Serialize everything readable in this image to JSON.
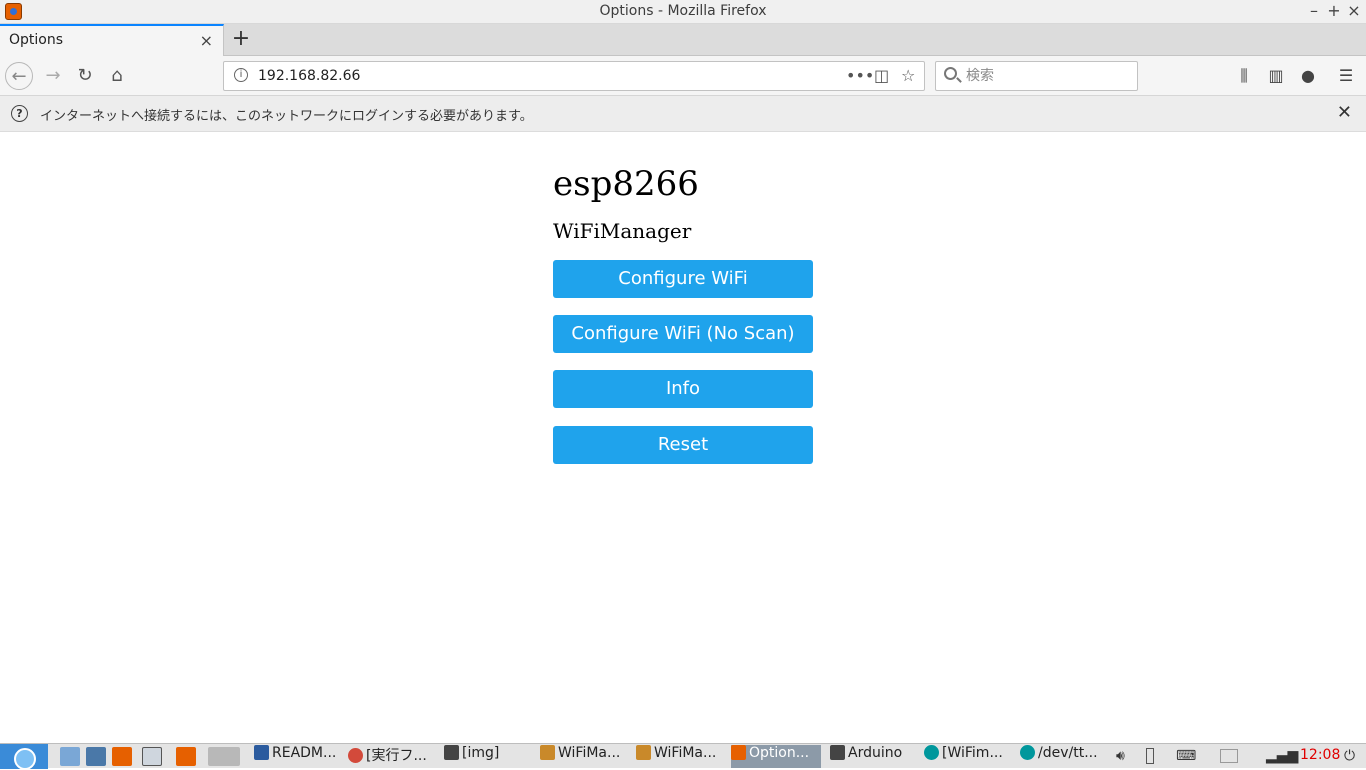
{
  "window": {
    "title": "Options - Mozilla Firefox"
  },
  "tabs": [
    {
      "label": "Options",
      "active": true
    }
  ],
  "navbar": {
    "url": "192.168.82.66",
    "search_placeholder": "検索"
  },
  "notification": {
    "message": "インターネットへ接続するには、このネットワークにログインする必要があります。"
  },
  "page": {
    "heading": "esp8266",
    "subheading": "WiFiManager",
    "buttons": [
      {
        "label": "Configure WiFi"
      },
      {
        "label": "Configure WiFi (No Scan)"
      },
      {
        "label": "Info"
      },
      {
        "label": "Reset"
      }
    ],
    "button_color": "#1fa3ec"
  },
  "taskbar": {
    "tasks": [
      {
        "label": "READM...",
        "icon": "vscode-icon"
      },
      {
        "label": "[実行フ...",
        "icon": "chrome-icon"
      },
      {
        "label": "[img]",
        "icon": "folder-icon"
      },
      {
        "label": "WiFiMa...",
        "icon": "image-viewer-icon"
      },
      {
        "label": "WiFiMa...",
        "icon": "image-viewer-icon"
      },
      {
        "label": "Option...",
        "icon": "firefox-icon",
        "active": true
      },
      {
        "label": "Arduino",
        "icon": "folder-icon"
      },
      {
        "label": "[WiFim...",
        "icon": "arduino-icon"
      },
      {
        "label": "/dev/tt...",
        "icon": "arduino-icon"
      }
    ],
    "clock": "12:08"
  }
}
